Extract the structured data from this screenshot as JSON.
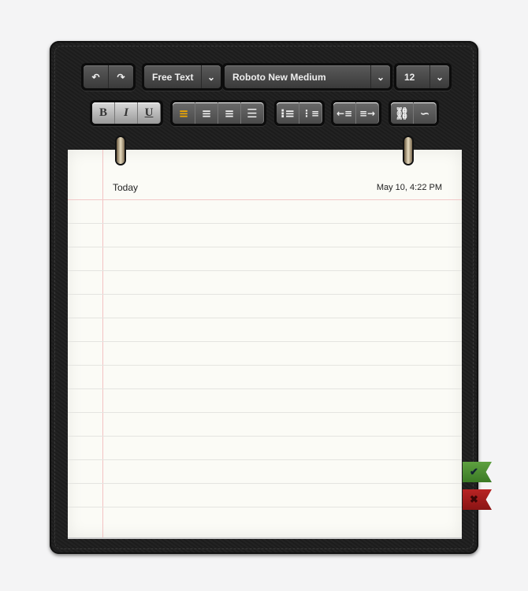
{
  "toolbar": {
    "style_select": "Free Text",
    "font_select": "Roboto New Medium",
    "size_select": "12",
    "bold": "B",
    "italic": "I",
    "underline": "U"
  },
  "note": {
    "title": "Today",
    "date": "May 10, 4:22 PM"
  },
  "colors": {
    "accent": "#f0a800",
    "confirm": "#4a8a2e",
    "cancel": "#a01c1c"
  },
  "icons": [
    "undo-icon",
    "redo-icon",
    "chevron-down-icon",
    "align-left-icon",
    "align-center-icon",
    "align-right-icon",
    "justify-icon",
    "bulleted-list-icon",
    "numbered-list-icon",
    "outdent-icon",
    "indent-icon",
    "link-icon",
    "unlink-icon",
    "check-icon",
    "close-icon"
  ]
}
